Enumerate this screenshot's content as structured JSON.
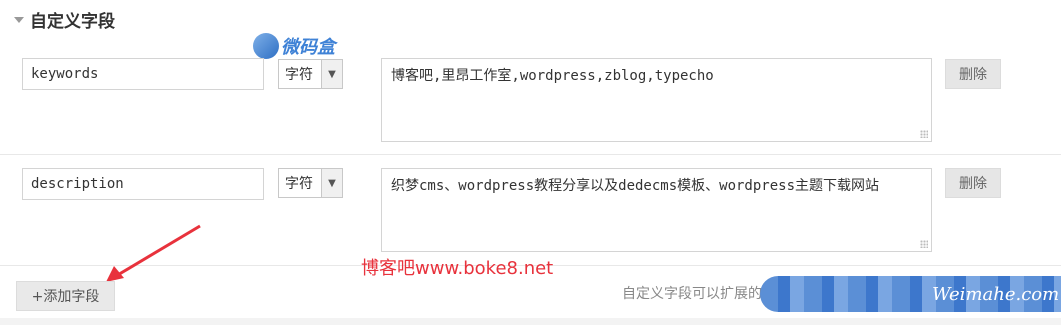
{
  "panel": {
    "title": "自定义字段"
  },
  "watermarks": {
    "top_logo_text": "微码盒",
    "middle": "博客吧www.boke8.net",
    "bottom": "Weimahe.com"
  },
  "fields": [
    {
      "name": "keywords",
      "type": "字符",
      "value": "博客吧,里昂工作室,wordpress,zblog,typecho",
      "delete_label": "删除"
    },
    {
      "name": "description",
      "type": "字符",
      "value": "织梦cms、wordpress教程分享以及dedecms模板、wordpress主题下载网站",
      "delete_label": "删除"
    }
  ],
  "add_button": {
    "label": "+添加字段"
  },
  "hint": "自定义字段可以扩展的",
  "icons": {
    "caret": "caret-down-icon",
    "select_arrow": "chevron-down-icon",
    "annotation": "red-arrow-icon"
  },
  "colors": {
    "annotation_red": "#e8323c",
    "watermark_blue": "#3f82d6"
  }
}
